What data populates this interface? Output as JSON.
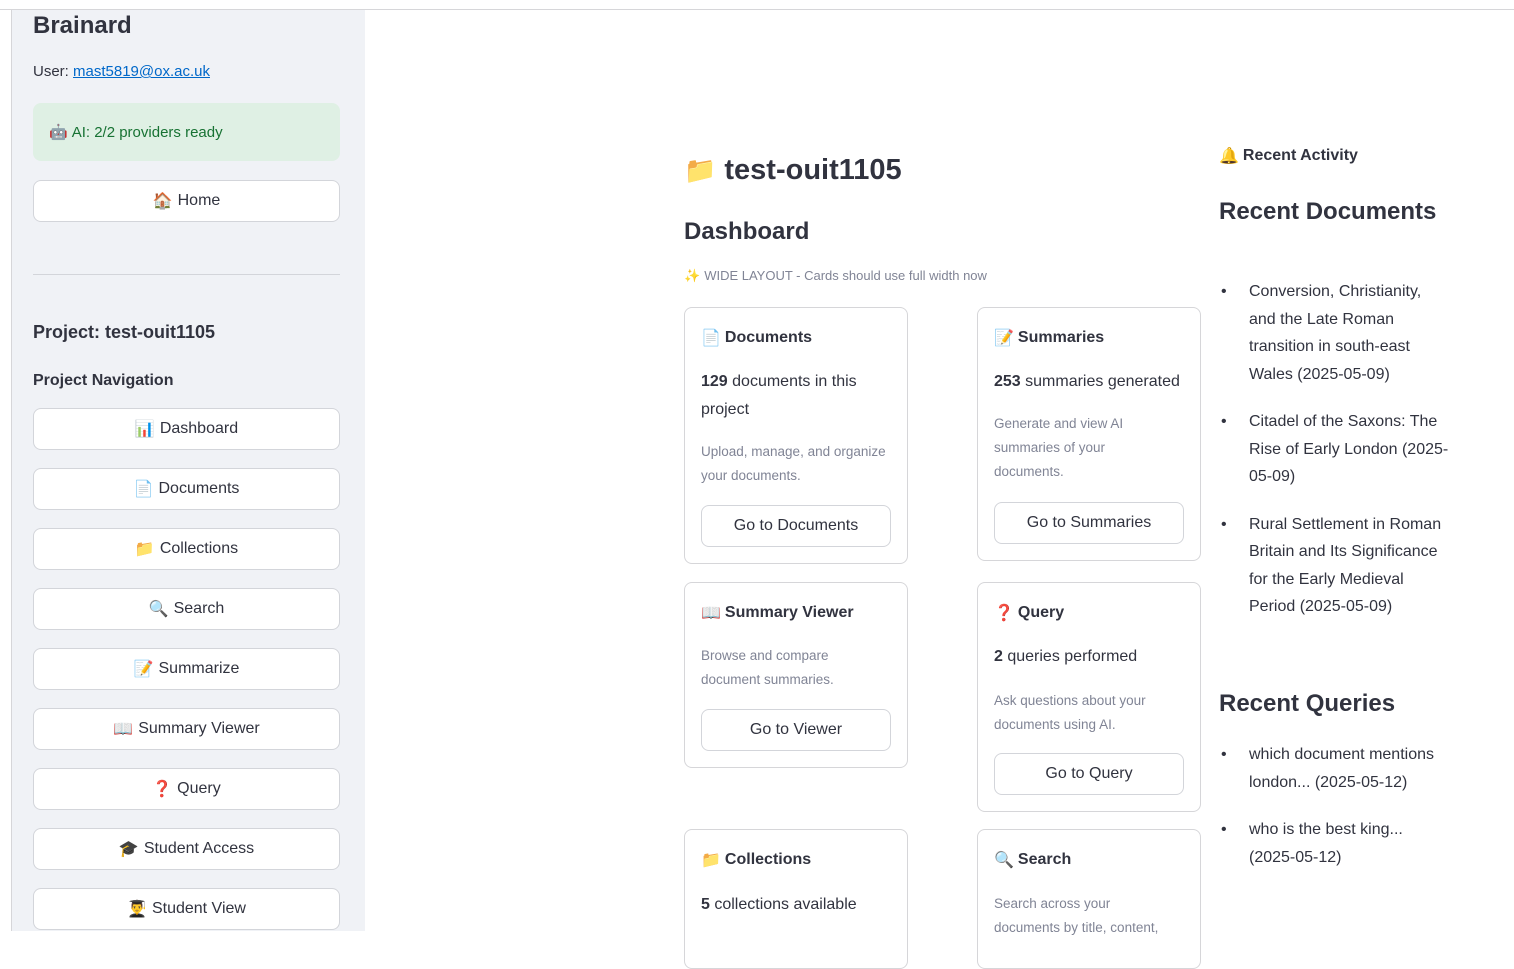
{
  "sidebar": {
    "app_title": "Brainard",
    "user_prefix": "User: ",
    "user_email": "mast5819@ox.ac.uk",
    "ai_status": {
      "icon": "🤖",
      "text": "AI: 2/2 providers ready"
    },
    "home": {
      "icon": "🏠",
      "label": "Home"
    },
    "project_label": "Project: test-ouit1105",
    "nav_title": "Project Navigation",
    "nav_items": [
      {
        "icon": "📊",
        "label": "Dashboard"
      },
      {
        "icon": "📄",
        "label": "Documents"
      },
      {
        "icon": "📁",
        "label": "Collections"
      },
      {
        "icon": "🔍",
        "label": "Search"
      },
      {
        "icon": "📝",
        "label": "Summarize"
      },
      {
        "icon": "📖",
        "label": "Summary Viewer"
      },
      {
        "icon": "❓",
        "label": "Query"
      },
      {
        "icon": "🎓",
        "label": "Student Access"
      },
      {
        "icon": "👨‍🎓",
        "label": "Student View"
      }
    ]
  },
  "main": {
    "title_icon": "📁",
    "title": "test-ouit1105",
    "dashboard_title": "Dashboard",
    "wide_note_icon": "✨",
    "wide_note": "WIDE LAYOUT - Cards should use full width now",
    "cards": {
      "documents": {
        "icon": "📄",
        "title": "Documents",
        "stat_number": "129",
        "stat_text": " documents in this project",
        "desc": "Upload, manage, and organize your documents.",
        "button": "Go to Documents"
      },
      "summaries": {
        "icon": "📝",
        "title": "Summaries",
        "stat_number": "253",
        "stat_text": " summaries generated",
        "desc": "Generate and view AI summaries of your documents.",
        "button": "Go to Summaries"
      },
      "viewer": {
        "icon": "📖",
        "title": "Summary Viewer",
        "desc": "Browse and compare document summaries.",
        "button": "Go to Viewer"
      },
      "query": {
        "icon": "❓",
        "title": "Query",
        "stat_number": "2",
        "stat_text": " queries performed",
        "desc": "Ask questions about your documents using AI.",
        "button": "Go to Query"
      },
      "collections": {
        "icon": "📁",
        "title": "Collections",
        "stat_number": "5",
        "stat_text": " collections available"
      },
      "search": {
        "icon": "🔍",
        "title": "Search",
        "desc": "Search across your documents by title, content,"
      }
    }
  },
  "right": {
    "activity_icon": "🔔",
    "activity_label": "Recent Activity",
    "recent_docs_title": "Recent Documents",
    "recent_docs": [
      "Conversion, Christianity, and the Late Roman transition in south-east Wales (2025-05-09)",
      "Citadel of the Saxons: The Rise of Early London (2025-05-09)",
      "Rural Settlement in Roman Britain and Its Significance for the Early Medieval Period (2025-05-09)"
    ],
    "recent_queries_title": "Recent Queries",
    "recent_queries": [
      "which document mentions london... (2025-05-12)",
      "who is the best king... (2025-05-12)"
    ]
  }
}
